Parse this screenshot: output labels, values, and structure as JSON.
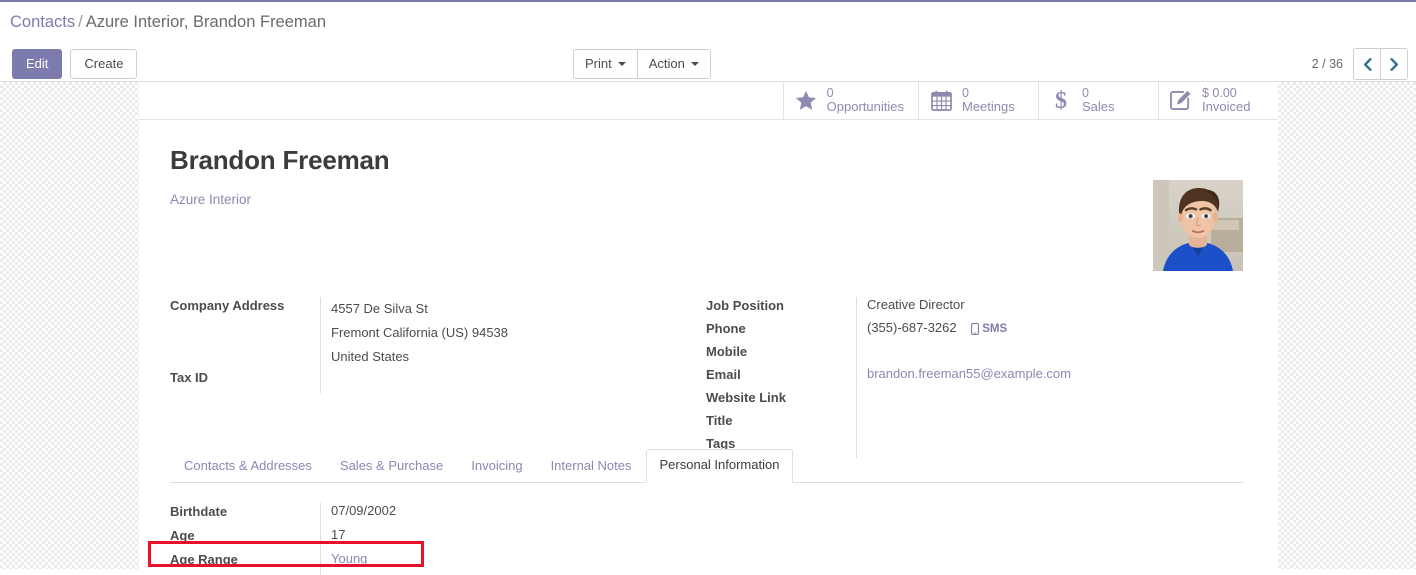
{
  "breadcrumb": {
    "root": "Contacts",
    "separator": "/",
    "current": "Azure Interior, Brandon Freeman"
  },
  "toolbar": {
    "edit_label": "Edit",
    "create_label": "Create",
    "print_label": "Print",
    "action_label": "Action"
  },
  "pager": {
    "count": "2 / 36",
    "prev_icon": "chevron-left-icon",
    "next_icon": "chevron-right-icon"
  },
  "stat_buttons": [
    {
      "icon": "star-icon",
      "value": "0",
      "label": "Opportunities"
    },
    {
      "icon": "calendar-icon",
      "value": "0",
      "label": "Meetings"
    },
    {
      "icon": "dollar-icon",
      "value": "0",
      "label": "Sales"
    },
    {
      "icon": "pencil-square-icon",
      "value": "$ 0.00",
      "label": "Invoiced"
    }
  ],
  "record": {
    "name": "Brandon Freeman",
    "company": "Azure Interior",
    "avatar_alt": "contact-photo"
  },
  "left_fields": {
    "company_address_label": "Company Address",
    "address_line1": "4557 De Silva St",
    "address_line2": "Fremont  California (US)  94538",
    "address_line3": "United States",
    "tax_id_label": "Tax ID",
    "tax_id_value": ""
  },
  "right_fields": {
    "job_position_label": "Job Position",
    "job_position_value": "Creative Director",
    "phone_label": "Phone",
    "phone_value": "(355)-687-3262",
    "sms_label": "SMS",
    "mobile_label": "Mobile",
    "mobile_value": "",
    "email_label": "Email",
    "email_value": "brandon.freeman55@example.com",
    "website_label": "Website Link",
    "website_value": "",
    "title_label": "Title",
    "title_value": "",
    "tags_label": "Tags",
    "tags_value": ""
  },
  "tabs": [
    {
      "label": "Contacts & Addresses",
      "active": false
    },
    {
      "label": "Sales & Purchase",
      "active": false
    },
    {
      "label": "Invoicing",
      "active": false
    },
    {
      "label": "Internal Notes",
      "active": false
    },
    {
      "label": "Personal Information",
      "active": true
    }
  ],
  "personal_information": {
    "birthdate_label": "Birthdate",
    "birthdate_value": "07/09/2002",
    "age_label": "Age",
    "age_value": "17",
    "age_range_label": "Age Range",
    "age_range_value": "Young"
  },
  "colors": {
    "brand_purple": "#7c7bad",
    "muted_purple": "#8a89b2",
    "annotation_red": "#e8112d",
    "text_dark": "#3c3c3c"
  }
}
